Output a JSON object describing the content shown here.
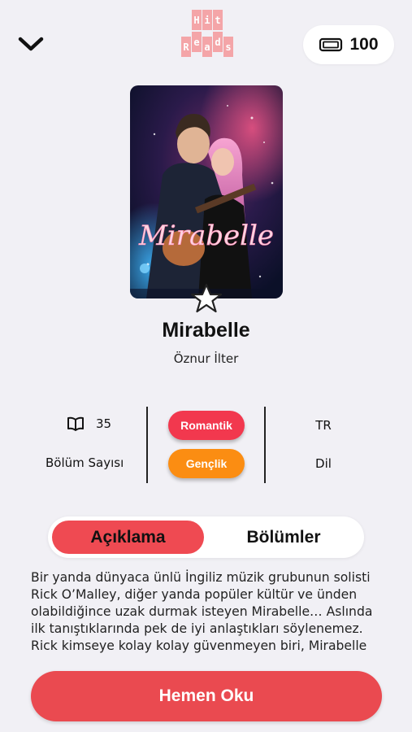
{
  "header": {
    "logo_letters_top": [
      "H",
      "i",
      "t"
    ],
    "logo_letters_bottom": [
      "R",
      "e",
      "a",
      "d",
      "s"
    ],
    "coins": "100",
    "icons": {
      "back": "chevron-down-icon",
      "coins": "ticket-icon"
    }
  },
  "book": {
    "cover_title": "Mirabelle",
    "title": "Mirabelle",
    "author": "Öznur İlter"
  },
  "stats": {
    "chapter_count": "35",
    "chapter_label": "Bölüm Sayısı",
    "genres": [
      "Romantik",
      "Gençlik"
    ],
    "language_code": "TR",
    "language_label": "Dil"
  },
  "tabs": {
    "description": "Açıklama",
    "chapters": "Bölümler",
    "active": "description"
  },
  "description": "Bir yanda dünyaca ünlü İngiliz müzik grubunun solisti Rick O’Malley, diğer yanda popüler kültür ve ünden olabildiğince uzak durmak isteyen Mirabelle… Aslında ilk tanıştıklarında pek de iyi anlaştıkları söylenemez. Rick kimseye kolay kolay güvenmeyen biri, Mirabelle ise onun dünyasından kaçmaya çalışıyor.",
  "cta": {
    "label": "Hemen Oku"
  },
  "colors": {
    "background": "#f1f0f5",
    "accent": "#ea4a50",
    "tag_romantik": "#f2384e",
    "tag_genclik": "#fb8d12",
    "logo": "#f4a5a8"
  }
}
